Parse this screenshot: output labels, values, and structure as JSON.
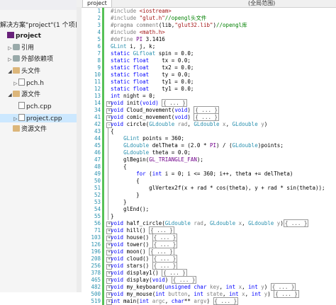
{
  "sidebar": {
    "header_text": "解决方案\"project\"(1 个项目",
    "items": [
      {
        "label": "project",
        "indent": 0,
        "icon": "project-icon",
        "toggle": "",
        "selected": false,
        "bold": true
      },
      {
        "label": "引用",
        "indent": 1,
        "icon": "references-icon",
        "toggle": "▷",
        "selected": false
      },
      {
        "label": "外部依赖项",
        "indent": 1,
        "icon": "external-deps-icon",
        "toggle": "▷",
        "selected": false
      },
      {
        "label": "头文件",
        "indent": 1,
        "icon": "folder-icon",
        "toggle": "◢",
        "selected": false
      },
      {
        "label": "pch.h",
        "indent": 2,
        "icon": "header-file-icon",
        "toggle": "▷",
        "selected": false
      },
      {
        "label": "源文件",
        "indent": 1,
        "icon": "folder-icon",
        "toggle": "◢",
        "selected": false
      },
      {
        "label": "pch.cpp",
        "indent": 2,
        "icon": "cpp-file-icon",
        "toggle": "",
        "selected": false
      },
      {
        "label": "project.cpp",
        "indent": 2,
        "icon": "cpp-file-icon",
        "toggle": "▷",
        "selected": true
      },
      {
        "label": "资源文件",
        "indent": 1,
        "icon": "folder-icon",
        "toggle": "",
        "selected": false
      }
    ]
  },
  "editor": {
    "tab_label": "project",
    "scope_label": "(全局范围)",
    "lines": [
      {
        "n": "1",
        "fold": "",
        "bar": true,
        "parts": [
          [
            "pp",
            "#include "
          ],
          [
            "s",
            "<iostream>"
          ]
        ]
      },
      {
        "n": "2",
        "fold": "",
        "bar": true,
        "parts": [
          [
            "pp",
            "#include "
          ],
          [
            "s",
            "\"glut.h\""
          ],
          [
            "c",
            "//opengl头文件"
          ]
        ]
      },
      {
        "n": "3",
        "fold": "",
        "bar": true,
        "parts": [
          [
            "pp",
            "#pragma comment"
          ],
          [
            "n",
            "(lib,"
          ],
          [
            "s",
            "\"glut32.lib\""
          ],
          [
            "n",
            ")"
          ],
          [
            "c",
            "//opengl库"
          ]
        ]
      },
      {
        "n": "4",
        "fold": "",
        "bar": true,
        "parts": [
          [
            "pp",
            "#include "
          ],
          [
            "s",
            "<math.h>"
          ]
        ]
      },
      {
        "n": "5",
        "fold": "",
        "bar": true,
        "parts": [
          [
            "pp",
            "#define "
          ],
          [
            "m",
            "PI"
          ],
          [
            "n",
            " 3.1416"
          ]
        ]
      },
      {
        "n": "6",
        "fold": "",
        "bar": true,
        "parts": [
          [
            "t",
            "GLint"
          ],
          [
            "n",
            " i, j, k;"
          ]
        ]
      },
      {
        "n": "7",
        "fold": "",
        "bar": true,
        "parts": [
          [
            "k",
            "static "
          ],
          [
            "t",
            "GLfloat"
          ],
          [
            "n",
            " spin = 0.0;"
          ]
        ]
      },
      {
        "n": "8",
        "fold": "",
        "bar": true,
        "parts": [
          [
            "k",
            "static "
          ],
          [
            "k",
            "float"
          ],
          [
            "n",
            "    tx = 0.0;"
          ]
        ]
      },
      {
        "n": "9",
        "fold": "",
        "bar": true,
        "parts": [
          [
            "k",
            "static "
          ],
          [
            "k",
            "float"
          ],
          [
            "n",
            "    tx2 = 0.0;"
          ]
        ]
      },
      {
        "n": "10",
        "fold": "",
        "bar": true,
        "parts": [
          [
            "k",
            "static "
          ],
          [
            "k",
            "float"
          ],
          [
            "n",
            "    ty = 0.0;"
          ]
        ]
      },
      {
        "n": "11",
        "fold": "",
        "bar": true,
        "parts": [
          [
            "k",
            "static "
          ],
          [
            "k",
            "float"
          ],
          [
            "n",
            "    ty1 = 0.0;"
          ]
        ]
      },
      {
        "n": "12",
        "fold": "",
        "bar": true,
        "parts": [
          [
            "k",
            "static "
          ],
          [
            "k",
            "float"
          ],
          [
            "n",
            "    ty1 = 0.0;"
          ]
        ]
      },
      {
        "n": "13",
        "fold": "",
        "bar": true,
        "parts": [
          [
            "k",
            "int"
          ],
          [
            "n",
            " night = 0;"
          ]
        ]
      },
      {
        "n": "14",
        "fold": "+",
        "bar": true,
        "parts": [
          [
            "k",
            "void"
          ],
          [
            "n",
            " init"
          ],
          [
            "k",
            "(void)"
          ],
          [
            "n",
            " "
          ],
          [
            "box",
            "{ ... }"
          ]
        ]
      },
      {
        "n": "34",
        "fold": "+",
        "bar": true,
        "parts": [
          [
            "k",
            "void"
          ],
          [
            "n",
            " Cloud_movement"
          ],
          [
            "n",
            "("
          ],
          [
            "k",
            "void"
          ],
          [
            "n",
            ") "
          ],
          [
            "box",
            "{ ... }"
          ]
        ]
      },
      {
        "n": "41",
        "fold": "+",
        "bar": true,
        "parts": [
          [
            "k",
            "void"
          ],
          [
            "n",
            " comic_movement"
          ],
          [
            "n",
            "("
          ],
          [
            "k",
            "void"
          ],
          [
            "n",
            ") "
          ],
          [
            "box",
            "{ ... }"
          ]
        ]
      },
      {
        "n": "42",
        "fold": "-",
        "bar": true,
        "parts": [
          [
            "k",
            "void"
          ],
          [
            "n",
            " circle("
          ],
          [
            "t",
            "GLdouble"
          ],
          [
            "pa",
            " rad"
          ],
          [
            "n",
            ", "
          ],
          [
            "t",
            "GLdouble"
          ],
          [
            "pa",
            " x"
          ],
          [
            "n",
            ", "
          ],
          [
            "t",
            "GLdouble"
          ],
          [
            "pa",
            " y"
          ],
          [
            "n",
            ")"
          ]
        ]
      },
      {
        "n": "43",
        "fold": "",
        "bar": true,
        "parts": [
          [
            "n",
            "{"
          ]
        ]
      },
      {
        "n": "44",
        "fold": "",
        "bar": true,
        "parts": [
          [
            "n",
            "    "
          ],
          [
            "t",
            "GLint"
          ],
          [
            "n",
            " points = 360;"
          ]
        ]
      },
      {
        "n": "45",
        "fold": "",
        "bar": true,
        "parts": [
          [
            "n",
            "    "
          ],
          [
            "t",
            "GLdouble"
          ],
          [
            "n",
            " delTheta = (2.0 * "
          ],
          [
            "m",
            "PI"
          ],
          [
            "n",
            ") / ("
          ],
          [
            "t",
            "GLdouble"
          ],
          [
            "n",
            ")points;"
          ]
        ]
      },
      {
        "n": "46",
        "fold": "",
        "bar": true,
        "parts": [
          [
            "n",
            "    "
          ],
          [
            "t",
            "GLdouble"
          ],
          [
            "n",
            " theta = 0.0;"
          ]
        ]
      },
      {
        "n": "47",
        "fold": "",
        "bar": true,
        "parts": [
          [
            "n",
            "    glBegin("
          ],
          [
            "m",
            "GL_TRIANGLE_FAN"
          ],
          [
            "n",
            ");"
          ]
        ]
      },
      {
        "n": "48",
        "fold": "",
        "bar": true,
        "parts": [
          [
            "n",
            "    {"
          ]
        ]
      },
      {
        "n": "49",
        "fold": "",
        "bar": true,
        "parts": [
          [
            "n",
            "        "
          ],
          [
            "k",
            "for"
          ],
          [
            "n",
            " ("
          ],
          [
            "k",
            "int"
          ],
          [
            "n",
            " i = 0; i <= 360; i++, theta += delTheta)"
          ]
        ]
      },
      {
        "n": "50",
        "fold": "",
        "bar": true,
        "parts": [
          [
            "n",
            "        {"
          ]
        ]
      },
      {
        "n": "51",
        "fold": "",
        "bar": true,
        "parts": [
          [
            "n",
            "            glVertex2f(x + rad * cos(theta), y + rad * sin(theta));"
          ]
        ]
      },
      {
        "n": "52",
        "fold": "",
        "bar": true,
        "parts": [
          [
            "n",
            "        }"
          ]
        ]
      },
      {
        "n": "53",
        "fold": "",
        "bar": true,
        "parts": [
          [
            "n",
            "    }"
          ]
        ]
      },
      {
        "n": "54",
        "fold": "",
        "bar": true,
        "parts": [
          [
            "n",
            "    glEnd();"
          ]
        ]
      },
      {
        "n": "55",
        "fold": "",
        "bar": true,
        "parts": [
          [
            "n",
            "}"
          ]
        ]
      },
      {
        "n": "56",
        "fold": "+",
        "bar": true,
        "parts": [
          [
            "k",
            "void"
          ],
          [
            "n",
            " half_circle("
          ],
          [
            "t",
            "GLdouble"
          ],
          [
            "pa",
            " rad"
          ],
          [
            "n",
            ", "
          ],
          [
            "t",
            "GLdouble"
          ],
          [
            "pa",
            " x"
          ],
          [
            "n",
            ", "
          ],
          [
            "t",
            "GLdouble"
          ],
          [
            "pa",
            " y"
          ],
          [
            "n",
            ")"
          ],
          [
            "box",
            "{ ... }"
          ]
        ]
      },
      {
        "n": "71",
        "fold": "+",
        "bar": true,
        "parts": [
          [
            "k",
            "void"
          ],
          [
            "n",
            " hill() "
          ],
          [
            "box",
            "{ ... }"
          ]
        ]
      },
      {
        "n": "103",
        "fold": "+",
        "bar": true,
        "parts": [
          [
            "k",
            "void"
          ],
          [
            "n",
            " house() "
          ],
          [
            "box",
            "{ ... }"
          ]
        ]
      },
      {
        "n": "126",
        "fold": "+",
        "bar": true,
        "parts": [
          [
            "k",
            "void"
          ],
          [
            "n",
            " tower() "
          ],
          [
            "box",
            "{ ... }"
          ]
        ]
      },
      {
        "n": "196",
        "fold": "+",
        "bar": true,
        "parts": [
          [
            "k",
            "void"
          ],
          [
            "n",
            " moon() "
          ],
          [
            "box",
            "{ ... }"
          ]
        ]
      },
      {
        "n": "208",
        "fold": "+",
        "bar": true,
        "parts": [
          [
            "k",
            "void"
          ],
          [
            "n",
            " cloud() "
          ],
          [
            "box",
            "{ ... }"
          ]
        ]
      },
      {
        "n": "256",
        "fold": "+",
        "bar": true,
        "parts": [
          [
            "k",
            "void"
          ],
          [
            "n",
            " stars() "
          ],
          [
            "box",
            "{ ... }"
          ]
        ]
      },
      {
        "n": "378",
        "fold": "+",
        "bar": true,
        "parts": [
          [
            "k",
            "void"
          ],
          [
            "n",
            " display1() "
          ],
          [
            "box",
            "{ ... }"
          ]
        ]
      },
      {
        "n": "465",
        "fold": "+",
        "bar": true,
        "parts": [
          [
            "k",
            "void"
          ],
          [
            "n",
            " display("
          ],
          [
            "k",
            "void"
          ],
          [
            "n",
            ") "
          ],
          [
            "box",
            "{ ... }"
          ]
        ]
      },
      {
        "n": "482",
        "fold": "+",
        "bar": true,
        "parts": [
          [
            "k",
            "void"
          ],
          [
            "n",
            " my_keyboard("
          ],
          [
            "k",
            "unsigned char"
          ],
          [
            "pa",
            " key"
          ],
          [
            "n",
            ", "
          ],
          [
            "k",
            "int"
          ],
          [
            "pa",
            " x"
          ],
          [
            "n",
            ", "
          ],
          [
            "k",
            "int"
          ],
          [
            "pa",
            " y"
          ],
          [
            "n",
            ") "
          ],
          [
            "box",
            "{ ... }"
          ]
        ]
      },
      {
        "n": "500",
        "fold": "+",
        "bar": true,
        "parts": [
          [
            "k",
            "void"
          ],
          [
            "n",
            " my_mouse("
          ],
          [
            "k",
            "int"
          ],
          [
            "pa",
            " button"
          ],
          [
            "n",
            ", "
          ],
          [
            "k",
            "int"
          ],
          [
            "pa",
            " state"
          ],
          [
            "n",
            ", "
          ],
          [
            "k",
            "int"
          ],
          [
            "pa",
            " x"
          ],
          [
            "n",
            ", "
          ],
          [
            "k",
            "int"
          ],
          [
            "pa",
            " y"
          ],
          [
            "n",
            ") "
          ],
          [
            "box",
            "{ ... }"
          ]
        ]
      },
      {
        "n": "519",
        "fold": "+",
        "bar": true,
        "parts": [
          [
            "k",
            "int"
          ],
          [
            "n",
            " main("
          ],
          [
            "k",
            "int"
          ],
          [
            "pa",
            " argc"
          ],
          [
            "n",
            ", "
          ],
          [
            "k",
            "char"
          ],
          [
            "n",
            "** "
          ],
          [
            "pa",
            "argv"
          ],
          [
            "n",
            ") "
          ],
          [
            "box",
            "{ ... }"
          ]
        ]
      }
    ]
  }
}
